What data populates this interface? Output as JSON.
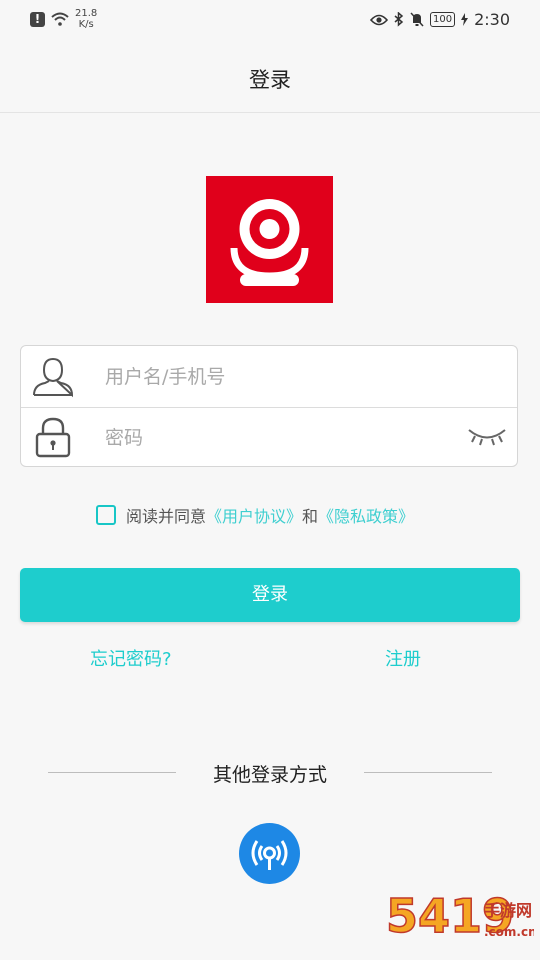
{
  "status_bar": {
    "alert": "!",
    "speed_value": "21.8",
    "speed_unit": "K/s",
    "battery": "100",
    "time": "2:30"
  },
  "header": {
    "title": "登录"
  },
  "form": {
    "username_placeholder": "用户名/手机号",
    "password_placeholder": "密码"
  },
  "agreement": {
    "prefix": "阅读并同意",
    "user_agreement": "《用户协议》",
    "and": "和",
    "privacy_policy": "《隐私政策》",
    "checked": false
  },
  "actions": {
    "login_label": "登录",
    "forgot_label": "忘记密码?",
    "register_label": "注册"
  },
  "other_login": {
    "title": "其他登录方式"
  },
  "watermark": {
    "digits": "5419",
    "text": "手游网",
    "domain": ".com.cn"
  },
  "colors": {
    "accent": "#1ecdcd",
    "logo_bg": "#e0001b",
    "other_icon": "#1e88e5"
  }
}
